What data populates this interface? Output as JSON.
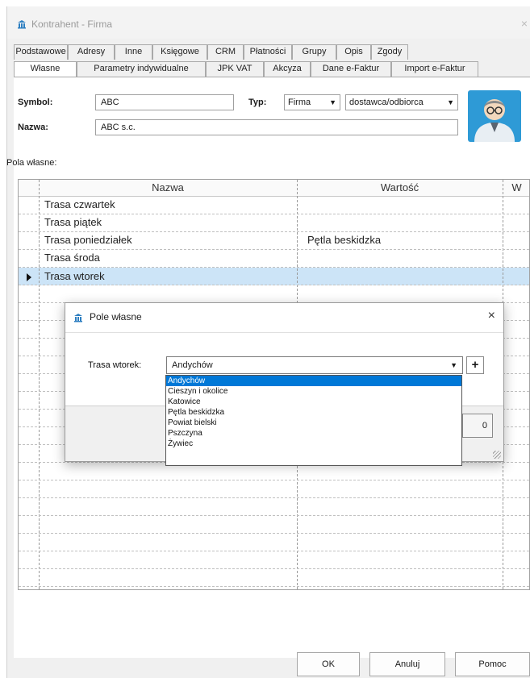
{
  "window": {
    "title": "Kontrahent - Firma",
    "close_label": "×"
  },
  "tabs_row1": [
    "Podstawowe",
    "Adresy",
    "Inne",
    "Księgowe",
    "CRM",
    "Płatności",
    "Grupy",
    "Opis",
    "Zgody"
  ],
  "tabs_row2": [
    "Własne",
    "Parametry indywidualne",
    "JPK VAT",
    "Akcyza",
    "Dane e-Faktur",
    "Import e-Faktur"
  ],
  "active_tab": "Własne",
  "form": {
    "symbol_label": "Symbol:",
    "symbol_value": "ABC",
    "typ_label": "Typ:",
    "typ_value": "Firma",
    "role_value": "dostawca/odbiorca",
    "nazwa_label": "Nazwa:",
    "nazwa_value": "ABC s.c."
  },
  "pola_label": "Pola własne:",
  "grid": {
    "columns": [
      "Nazwa",
      "Wartość",
      "W"
    ],
    "rows": [
      {
        "name": "Trasa czwartek",
        "value": ""
      },
      {
        "name": "Trasa piątek",
        "value": ""
      },
      {
        "name": "Trasa poniedziałek",
        "value": "Pętla beskidzka"
      },
      {
        "name": "Trasa środa",
        "value": ""
      },
      {
        "name": "Trasa wtorek",
        "value": ""
      }
    ],
    "selected_row": 4
  },
  "dialog": {
    "title": "Pole własne",
    "close_label": "×",
    "field_label": "Trasa wtorek:",
    "field_value": "Andychów",
    "add_label": "+",
    "button_label": "0"
  },
  "dropdown": {
    "options": [
      "Andychów",
      "Cieszyn i okolice",
      "Katowice",
      "Pętla beskidzka",
      "Powiat bielski",
      "Pszczyna",
      "Żywiec"
    ],
    "selected_index": 0
  },
  "buttons": {
    "ok": "OK",
    "cancel": "Anuluj",
    "help": "Pomoc"
  },
  "colors": {
    "selection": "#0078d7",
    "row_highlight": "#cce4f7",
    "avatar_bg": "#2e9ad6"
  }
}
